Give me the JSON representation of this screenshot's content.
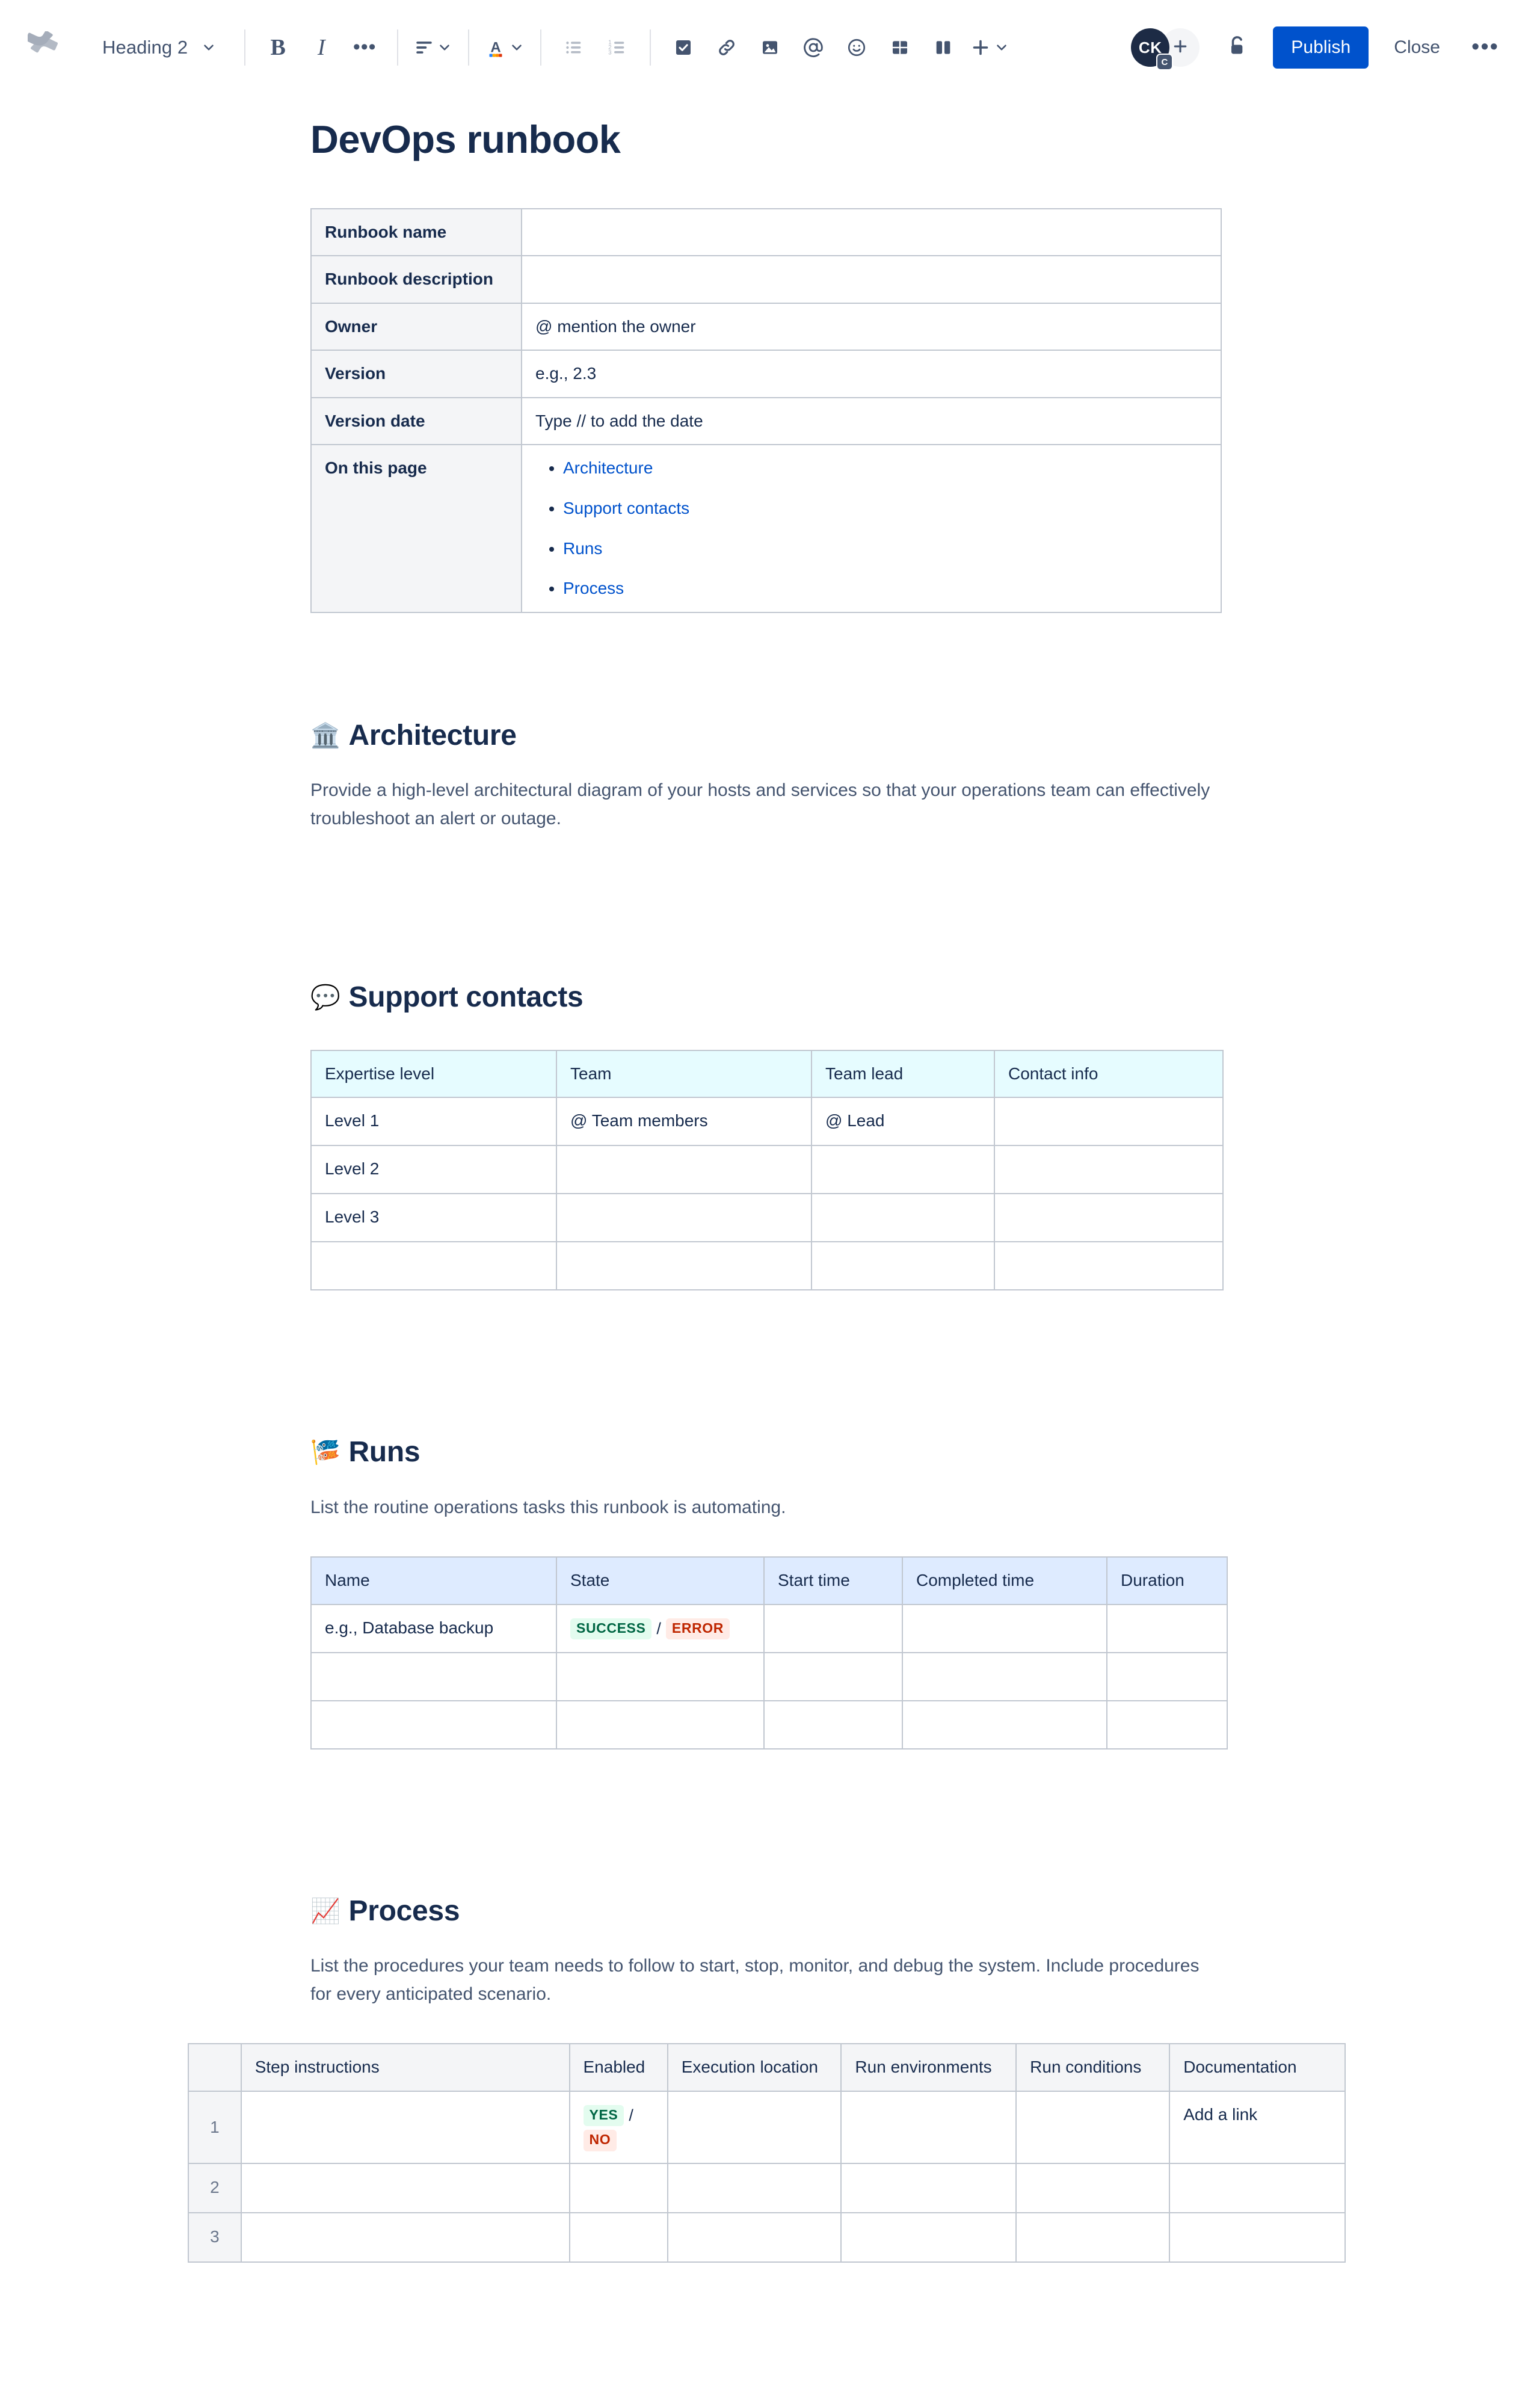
{
  "toolbar": {
    "logo_icon": "confluence-logo",
    "style_select": {
      "label": "Heading 2",
      "icon": "chevron-down-icon"
    },
    "buttons": [
      {
        "name": "bold-button",
        "label": "B",
        "icon": "bold-icon"
      },
      {
        "name": "italic-button",
        "label": "I",
        "icon": "italic-icon"
      },
      {
        "name": "more-formatting-button",
        "label": "•••",
        "icon": "ellipsis-icon"
      },
      {
        "name": "text-align-button",
        "label": "",
        "icon": "align-left-icon"
      },
      {
        "name": "text-color-button",
        "label": "A",
        "icon": "text-color-icon"
      },
      {
        "name": "bullet-list-button",
        "label": "",
        "icon": "bullet-list-icon"
      },
      {
        "name": "numbered-list-button",
        "label": "",
        "icon": "numbered-list-icon"
      },
      {
        "name": "task-list-button",
        "label": "",
        "icon": "checkbox-icon"
      },
      {
        "name": "link-button",
        "label": "",
        "icon": "link-icon"
      },
      {
        "name": "image-button",
        "label": "",
        "icon": "image-icon"
      },
      {
        "name": "mention-button",
        "label": "",
        "icon": "mention-at-icon"
      },
      {
        "name": "emoji-button",
        "label": "",
        "icon": "emoji-smiley-icon"
      },
      {
        "name": "table-button",
        "label": "",
        "icon": "table-grid-icon"
      },
      {
        "name": "layout-button",
        "label": "",
        "icon": "two-column-layout-icon"
      },
      {
        "name": "insert-button",
        "label": "",
        "icon": "plus-icon"
      }
    ],
    "avatar": {
      "initials": "CK",
      "badge": "C"
    },
    "add_person_icon": "plus-icon",
    "lock_icon": "unlocked-padlock-icon",
    "publish_label": "Publish",
    "close_label": "Close",
    "more_label": "•••",
    "accent_color": "#0052CC"
  },
  "document": {
    "title": "DevOps runbook",
    "meta_table": {
      "rows": [
        {
          "label": "Runbook name",
          "value": "",
          "placeholder": ""
        },
        {
          "label": "Runbook description",
          "value": "",
          "placeholder": ""
        },
        {
          "label": "Owner",
          "value": "",
          "placeholder": "@ mention the owner"
        },
        {
          "label": "Version",
          "value": "",
          "placeholder": "e.g., 2.3"
        },
        {
          "label": "Version date",
          "value": "",
          "placeholder": "Type // to add the date"
        }
      ],
      "on_this_page_label": "On this page",
      "on_this_page_links": [
        "Architecture",
        "Support contacts",
        "Runs",
        "Process"
      ]
    },
    "sections": [
      {
        "id": "architecture",
        "emoji": "🏛️",
        "emoji_name": "classical-building-emoji",
        "heading": "Architecture",
        "body": "Provide a high-level architectural diagram of your hosts and services so that your operations team can effectively troubleshoot an alert or outage."
      },
      {
        "id": "support-contacts",
        "emoji": "💬",
        "emoji_name": "speech-balloon-emoji",
        "heading": "Support contacts",
        "body": ""
      },
      {
        "id": "runs",
        "emoji": "🎏",
        "emoji_name": "carp-streamer-emoji",
        "heading": "Runs",
        "body": "List the routine operations tasks this runbook is automating."
      },
      {
        "id": "process",
        "emoji": "📈",
        "emoji_name": "chart-increasing-emoji",
        "heading": "Process",
        "body": "List the procedures your team needs to follow to start, stop, monitor, and debug the system. Include procedures for every anticipated scenario."
      }
    ],
    "support_table": {
      "headers": [
        "Expertise level",
        "Team",
        "Team lead",
        "Contact info"
      ],
      "rows": [
        {
          "level": "Level 1",
          "team": "@ Team members",
          "team_lead": "@ Lead",
          "contact": ""
        },
        {
          "level": "Level 2",
          "team": "",
          "team_lead": "",
          "contact": ""
        },
        {
          "level": "Level 3",
          "team": "",
          "team_lead": "",
          "contact": ""
        },
        {
          "level": "",
          "team": "",
          "team_lead": "",
          "contact": ""
        }
      ]
    },
    "runs_table": {
      "headers": [
        "Name",
        "State",
        "Start time",
        "Completed time",
        "Duration"
      ],
      "rows": [
        {
          "name": "e.g., Database backup",
          "state_success": "SUCCESS",
          "state_separator": "/",
          "state_error": "ERROR",
          "start": "",
          "completed": "",
          "duration": ""
        },
        {
          "name": "",
          "start": "",
          "completed": "",
          "duration": ""
        },
        {
          "name": "",
          "start": "",
          "completed": "",
          "duration": ""
        }
      ]
    },
    "process_table": {
      "headers": [
        "",
        "Step instructions",
        "Enabled",
        "Execution location",
        "Run environments",
        "Run conditions",
        "Documentation"
      ],
      "rows": [
        {
          "num": "1",
          "instructions": "",
          "enabled_yes": "YES",
          "enabled_separator": "/",
          "enabled_no": "NO",
          "exec_location": "",
          "run_envs": "",
          "run_conditions": "",
          "documentation": "Add a link"
        },
        {
          "num": "2",
          "instructions": "",
          "exec_location": "",
          "run_envs": "",
          "run_conditions": "",
          "documentation": ""
        },
        {
          "num": "3",
          "instructions": "",
          "exec_location": "",
          "run_envs": "",
          "run_conditions": "",
          "documentation": ""
        }
      ]
    }
  },
  "colors": {
    "publish_blue": "#0052CC",
    "link_blue": "#0052CC",
    "text_dark": "#172B4D",
    "text_subtle": "#6B778C",
    "border": "#C1C7D0",
    "grey_header": "#F4F5F7",
    "cyan_header": "#E6FCFF",
    "blue_header": "#DEEBFF",
    "success_bg": "#E3FCEF",
    "success_fg": "#006644",
    "error_bg": "#FFEBE6",
    "error_fg": "#BF2600"
  }
}
